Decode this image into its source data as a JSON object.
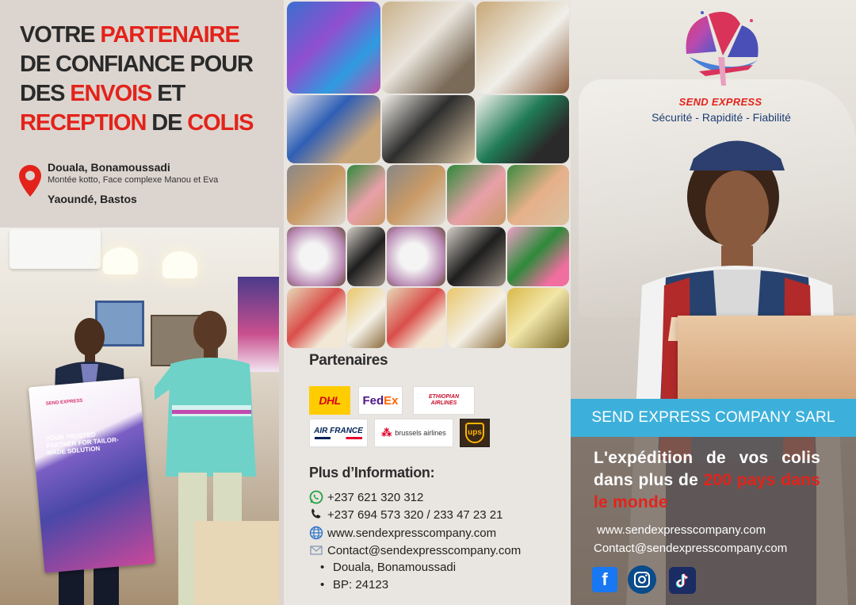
{
  "headline": {
    "line1_a": "VOTRE ",
    "line1_b": "PARTENAIRE",
    "line2": "DE CONFIANCE POUR",
    "line3_a": "DES ",
    "line3_b": "ENVOIS",
    "line3_c": " ET",
    "line4_a": "RECEPTION",
    "line4_b": " DE ",
    "line4_c": "COLIS"
  },
  "address": {
    "city1": "Douala, Bonamoussadi",
    "detail1": "Montée kotto, Face complexe Manou et Eva",
    "city2": "Yaoundé, Bastos"
  },
  "poster": {
    "brand": "SEND EXPRESS",
    "title": "YOUR TRUSTED PARTNER FOR TAILOR-MADE SOLUTION"
  },
  "partners": {
    "title": "Partenaires",
    "logos": {
      "dhl": "DHL",
      "fedex_a": "Fed",
      "fedex_b": "Ex",
      "ethiopian_a": "ETHIOPIAN",
      "ethiopian_b": "AIRLINES",
      "airfrance": "AIR FRANCE",
      "brussels": "brussels airlines",
      "ups": "ups"
    }
  },
  "info": {
    "title": "Plus d’Information:",
    "whatsapp": "+237 621 320 312",
    "phone": "+237 694 573 320 / 233 47 23 21",
    "website": "www.sendexpresscompany.com",
    "email": "Contact@sendexpresscompany.com",
    "bullets": [
      "Douala, Bonamoussadi",
      "BP: 24123"
    ]
  },
  "brand": {
    "name": "SEND EXPRESS",
    "tagline": "Sécurité - Rapidité - Fiabilité",
    "company": "SEND EXPRESS COMPANY SARL",
    "slogan_a": "L'expédition de vos colis dans plus de ",
    "slogan_b": "200 pays dans le monde",
    "website": "www.sendexpresscompany.com",
    "email": "Contact@sendexpresscompany.com",
    "social": [
      "facebook-icon",
      "instagram-icon",
      "tiktok-icon"
    ]
  },
  "colors": {
    "accent_red": "#e3231b",
    "bar_blue": "#3cb0db",
    "navy": "#1e3d73"
  }
}
